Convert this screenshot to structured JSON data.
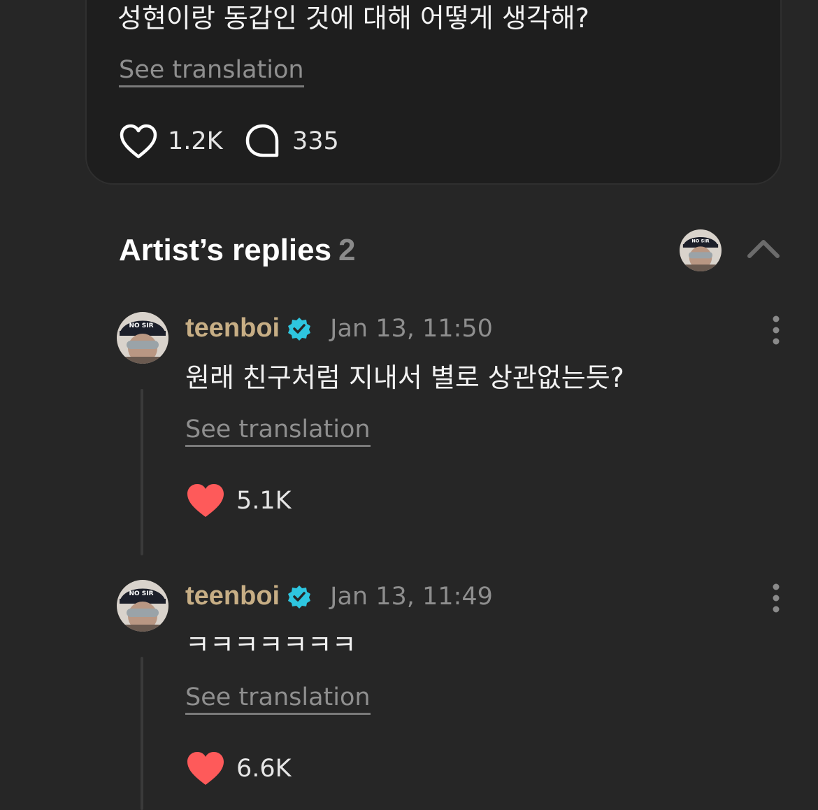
{
  "post": {
    "text": "성현이랑 동갑인 것에 대해 어떻게 생각해?",
    "see_translation": "See translation",
    "likes": "1.2K",
    "comments": "335"
  },
  "replies_section": {
    "title": "Artist’s replies",
    "count": "2",
    "avatar_cap_text": "NO SIR"
  },
  "replies": [
    {
      "username": "teenboi",
      "timestamp": "Jan 13, 11:50",
      "text": "원래 친구처럼 지내서 별로 상관없는듯?",
      "see_translation": "See translation",
      "likes": "5.1K"
    },
    {
      "username": "teenboi",
      "timestamp": "Jan 13, 11:49",
      "text": "ㅋㅋㅋㅋㅋㅋㅋ",
      "see_translation": "See translation",
      "likes": "6.6K"
    }
  ],
  "colors": {
    "background": "#262626",
    "card": "#1e1e1e",
    "username": "#c7ae85",
    "verified_badge": "#2ec6e0",
    "liked_heart": "#fe5a5a",
    "muted_text": "#8e8e8e"
  }
}
